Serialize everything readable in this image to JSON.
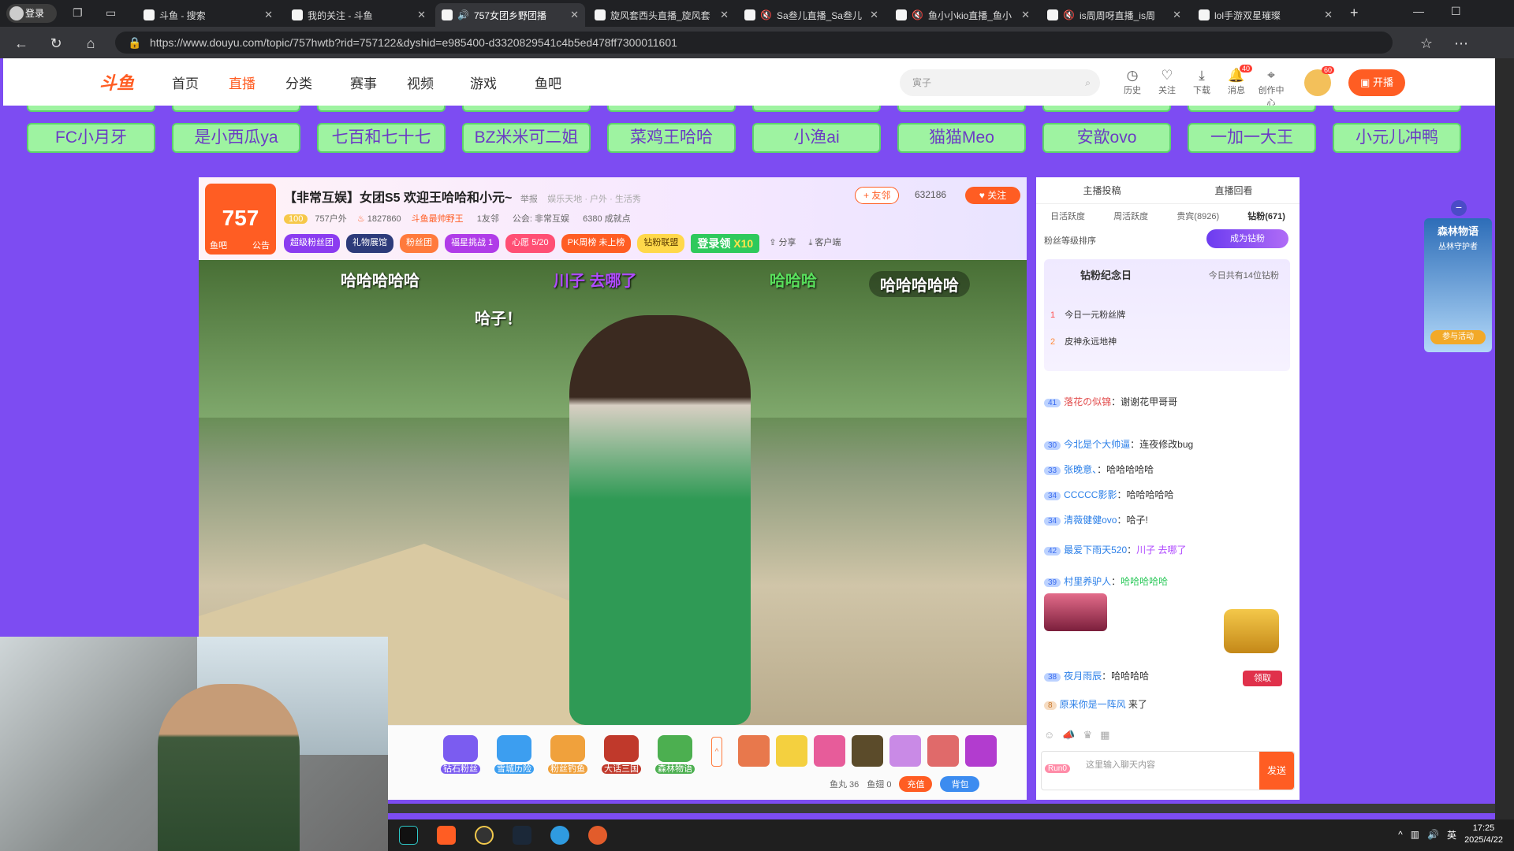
{
  "tabs": [
    {
      "label": "斗鱼 - 搜索",
      "active": false
    },
    {
      "label": "我的关注 - 斗鱼",
      "active": false
    },
    {
      "label": "757女团乡野团播",
      "active": true
    },
    {
      "label": "旋风套西头直播_旋风套",
      "active": false
    },
    {
      "label": "Sa叁儿直播_Sa叁儿",
      "active": false
    },
    {
      "label": "鱼小小kio直播_鱼小",
      "active": false
    },
    {
      "label": "is周周呀直播_is周",
      "active": false
    },
    {
      "label": "lol手游双星璀璨",
      "active": false
    }
  ],
  "login_label": "登录",
  "url": "https://www.douyu.com/topic/757hwtb?rid=757122&dyshid=e985400-d3320829541c4b5ed478ff7300011601",
  "nav": {
    "logo": "斗鱼",
    "items": [
      "首页",
      "直播",
      "分类",
      "赛事",
      "视频",
      "游戏",
      "鱼吧"
    ],
    "search_placeholder": "寅子",
    "top_icons": [
      "历史",
      "关注",
      "下载",
      "消息",
      "创作中心"
    ],
    "msg_badge": "40",
    "avatar_badge": "60",
    "kaibo": "开播"
  },
  "chips": [
    "FC小月牙",
    "是小西瓜ya",
    "七百和七十七",
    "BZ米米可二姐",
    "菜鸡王哈哈",
    "小渔ai",
    "猫猫Meo",
    "安歆ovo",
    "一加一大王",
    "小元儿冲鸭"
  ],
  "room": {
    "logo_text": "757",
    "logo_badges": [
      "鱼吧",
      "公告"
    ],
    "title": "【非常互娱】女团S5 欢迎王哈哈和小元~",
    "report": "举报",
    "category": "娱乐天地 · 户外 · 生活秀",
    "add_friend": "+ 友邻",
    "hot": "632186",
    "follow": "关注",
    "level": "100",
    "anchor": "757户外",
    "fans": "1827860",
    "tag": "斗鱼最帅野王",
    "friends": "1友邻",
    "guild": "公会: 非常互娱",
    "score": "6380 成就点",
    "pills": [
      "超级粉丝团",
      "礼物展馆",
      "粉丝团",
      "福星挑战 1",
      "心愿 5/20",
      "PK周榜 未上榜",
      "钻粉联盟"
    ],
    "login_gift": "登录领",
    "login_gift_x": "X10",
    "share": "分享",
    "client": "客户端"
  },
  "danmu": [
    {
      "text": "哈哈哈哈哈",
      "color": "#ffffff"
    },
    {
      "text": "川子 去哪了",
      "color": "#b04bff"
    },
    {
      "text": "哈哈哈",
      "color": "#59e05c"
    },
    {
      "text": "哈哈哈哈哈",
      "color": "#ffffff"
    },
    {
      "text": "哈子！",
      "color": "#ffffff"
    }
  ],
  "gifts": [
    "钻石粉丝",
    "雪城历险",
    "粉丝钓鱼",
    "大话三国",
    "森林物语"
  ],
  "wallet": {
    "yuwan": "鱼丸 36",
    "yuchi": "鱼翅 0",
    "recharge": "充值",
    "bag": "背包"
  },
  "chat": {
    "top_tabs": [
      "主播投稿",
      "直播回看"
    ],
    "sub_tabs": [
      "日活跃度",
      "周活跃度",
      "贵宾(8926)",
      "钻粉(671)"
    ],
    "rank_label": "粉丝等级排序",
    "become_diamond": "成为钻粉",
    "anniv_title": "钻粉纪念日",
    "anniv_sub": "今日共有14位钻粉",
    "rank_rows": [
      {
        "rank": "1",
        "name": "今日一元粉丝牌"
      },
      {
        "rank": "2",
        "name": "皮神永远地神"
      }
    ],
    "messages": [
      {
        "lvl": "41",
        "nick": "落花の似锦",
        "text": "谢谢花甲哥哥"
      },
      {
        "lvl": "30",
        "nick": "今北是个大帅逼",
        "text": "连夜修改bug"
      },
      {
        "lvl": "33",
        "nick": "张晚意、",
        "text": "哈哈哈哈哈"
      },
      {
        "lvl": "34",
        "nick": "CCCCC影影",
        "text": "哈哈哈哈哈"
      },
      {
        "lvl": "34",
        "nick": "清薇健健ovo",
        "text": "哈子!"
      },
      {
        "lvl": "42",
        "nick": "最爱下雨天520",
        "text": "川子 去哪了"
      },
      {
        "lvl": "39",
        "nick": "村里养驴人",
        "text": "哈哈哈哈哈"
      },
      {
        "lvl": "38",
        "nick": "夜月雨辰",
        "text": "哈哈哈哈"
      },
      {
        "lvl": "8",
        "nick": "原来你是一阵风",
        "text": "来了"
      }
    ],
    "receive": "领取",
    "input_placeholder": "这里输入聊天内容",
    "send": "发送",
    "input_badge": "Run0"
  },
  "float_card": {
    "title": "森林物语",
    "sub": "丛林守护者",
    "btn": "参与活动"
  },
  "taskbar": {
    "time": "17:25",
    "date": "2025/4/22",
    "ime": "英"
  },
  "colors": {
    "accent": "#ff5d23",
    "page_bg": "#7d4cf2",
    "chip_bg": "#9ef3a1"
  }
}
